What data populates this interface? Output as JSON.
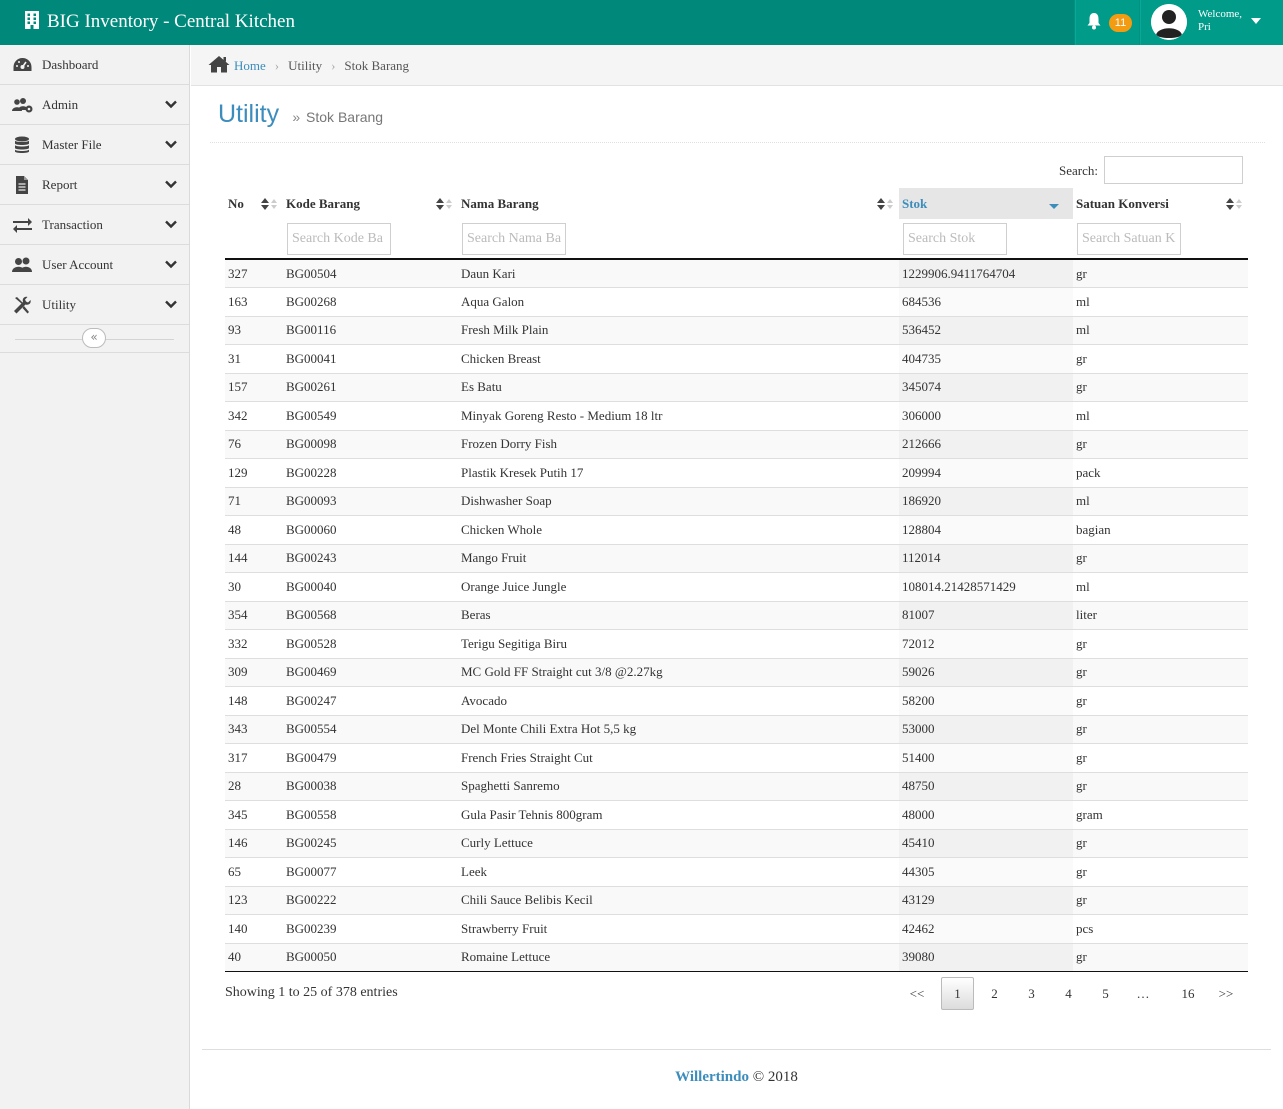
{
  "header": {
    "brand": "BIG Inventory - Central Kitchen",
    "notifications_count": "11",
    "welcome_label": "Welcome,",
    "user_name": "Pri"
  },
  "sidebar": {
    "items": [
      {
        "label": "Dashboard",
        "icon": "dashboard-icon"
      },
      {
        "label": "Admin",
        "icon": "users-cog-icon"
      },
      {
        "label": "Master File",
        "icon": "database-icon"
      },
      {
        "label": "Report",
        "icon": "file-icon"
      },
      {
        "label": "Transaction",
        "icon": "exchange-icon"
      },
      {
        "label": "User Account",
        "icon": "user-group-icon"
      },
      {
        "label": "Utility",
        "icon": "tools-icon"
      }
    ],
    "collapse_glyph": "«"
  },
  "breadcrumb": {
    "home": "Home",
    "items": [
      "Utility",
      "Stok Barang"
    ]
  },
  "page": {
    "title": "Utility",
    "subtitle": "Stok Barang"
  },
  "search": {
    "label": "Search:",
    "value": ""
  },
  "table": {
    "columns": [
      "No",
      "Kode Barang",
      "Nama Barang",
      "Stok",
      "Satuan Konversi"
    ],
    "filters": {
      "kode": "Search Kode Ba",
      "nama": "Search Nama Ba",
      "stok": "Search Stok",
      "satuan": "Search Satuan K"
    },
    "rows": [
      [
        "327",
        "BG00504",
        "Daun Kari",
        "1229906.9411764704",
        "gr"
      ],
      [
        "163",
        "BG00268",
        "Aqua Galon",
        "684536",
        "ml"
      ],
      [
        "93",
        "BG00116",
        "Fresh Milk Plain",
        "536452",
        "ml"
      ],
      [
        "31",
        "BG00041",
        "Chicken Breast",
        "404735",
        "gr"
      ],
      [
        "157",
        "BG00261",
        "Es Batu",
        "345074",
        "gr"
      ],
      [
        "342",
        "BG00549",
        "Minyak Goreng Resto - Medium 18 ltr",
        "306000",
        "ml"
      ],
      [
        "76",
        "BG00098",
        "Frozen Dorry Fish",
        "212666",
        "gr"
      ],
      [
        "129",
        "BG00228",
        "Plastik Kresek Putih 17",
        "209994",
        "pack"
      ],
      [
        "71",
        "BG00093",
        "Dishwasher Soap",
        "186920",
        "ml"
      ],
      [
        "48",
        "BG00060",
        "Chicken Whole",
        "128804",
        "bagian"
      ],
      [
        "144",
        "BG00243",
        "Mango Fruit",
        "112014",
        "gr"
      ],
      [
        "30",
        "BG00040",
        "Orange Juice Jungle",
        "108014.21428571429",
        "ml"
      ],
      [
        "354",
        "BG00568",
        "Beras",
        "81007",
        "liter"
      ],
      [
        "332",
        "BG00528",
        "Terigu Segitiga Biru",
        "72012",
        "gr"
      ],
      [
        "309",
        "BG00469",
        "MC Gold FF Straight cut 3/8 @2.27kg",
        "59026",
        "gr"
      ],
      [
        "148",
        "BG00247",
        "Avocado",
        "58200",
        "gr"
      ],
      [
        "343",
        "BG00554",
        "Del Monte Chili Extra Hot 5,5 kg",
        "53000",
        "gr"
      ],
      [
        "317",
        "BG00479",
        "French Fries Straight Cut",
        "51400",
        "gr"
      ],
      [
        "28",
        "BG00038",
        "Spaghetti Sanremo",
        "48750",
        "gr"
      ],
      [
        "345",
        "BG00558",
        "Gula Pasir Tehnis 800gram",
        "48000",
        "gram"
      ],
      [
        "146",
        "BG00245",
        "Curly Lettuce",
        "45410",
        "gr"
      ],
      [
        "65",
        "BG00077",
        "Leek",
        "44305",
        "gr"
      ],
      [
        "123",
        "BG00222",
        "Chili Sauce Belibis Kecil",
        "43129",
        "gr"
      ],
      [
        "140",
        "BG00239",
        "Strawberry Fruit",
        "42462",
        "pcs"
      ],
      [
        "40",
        "BG00050",
        "Romaine Lettuce",
        "39080",
        "gr"
      ]
    ]
  },
  "info": "Showing 1 to 25 of 378 entries",
  "pagination": {
    "items": [
      "<<",
      "1",
      "2",
      "3",
      "4",
      "5",
      "…",
      "16",
      ">>"
    ],
    "active": "1"
  },
  "footer": {
    "company": "Willertindo",
    "copyright": "© 2018"
  },
  "colors": {
    "topbar": "#00897b",
    "accent": "#3c8dbc",
    "badge": "#f39c12"
  }
}
